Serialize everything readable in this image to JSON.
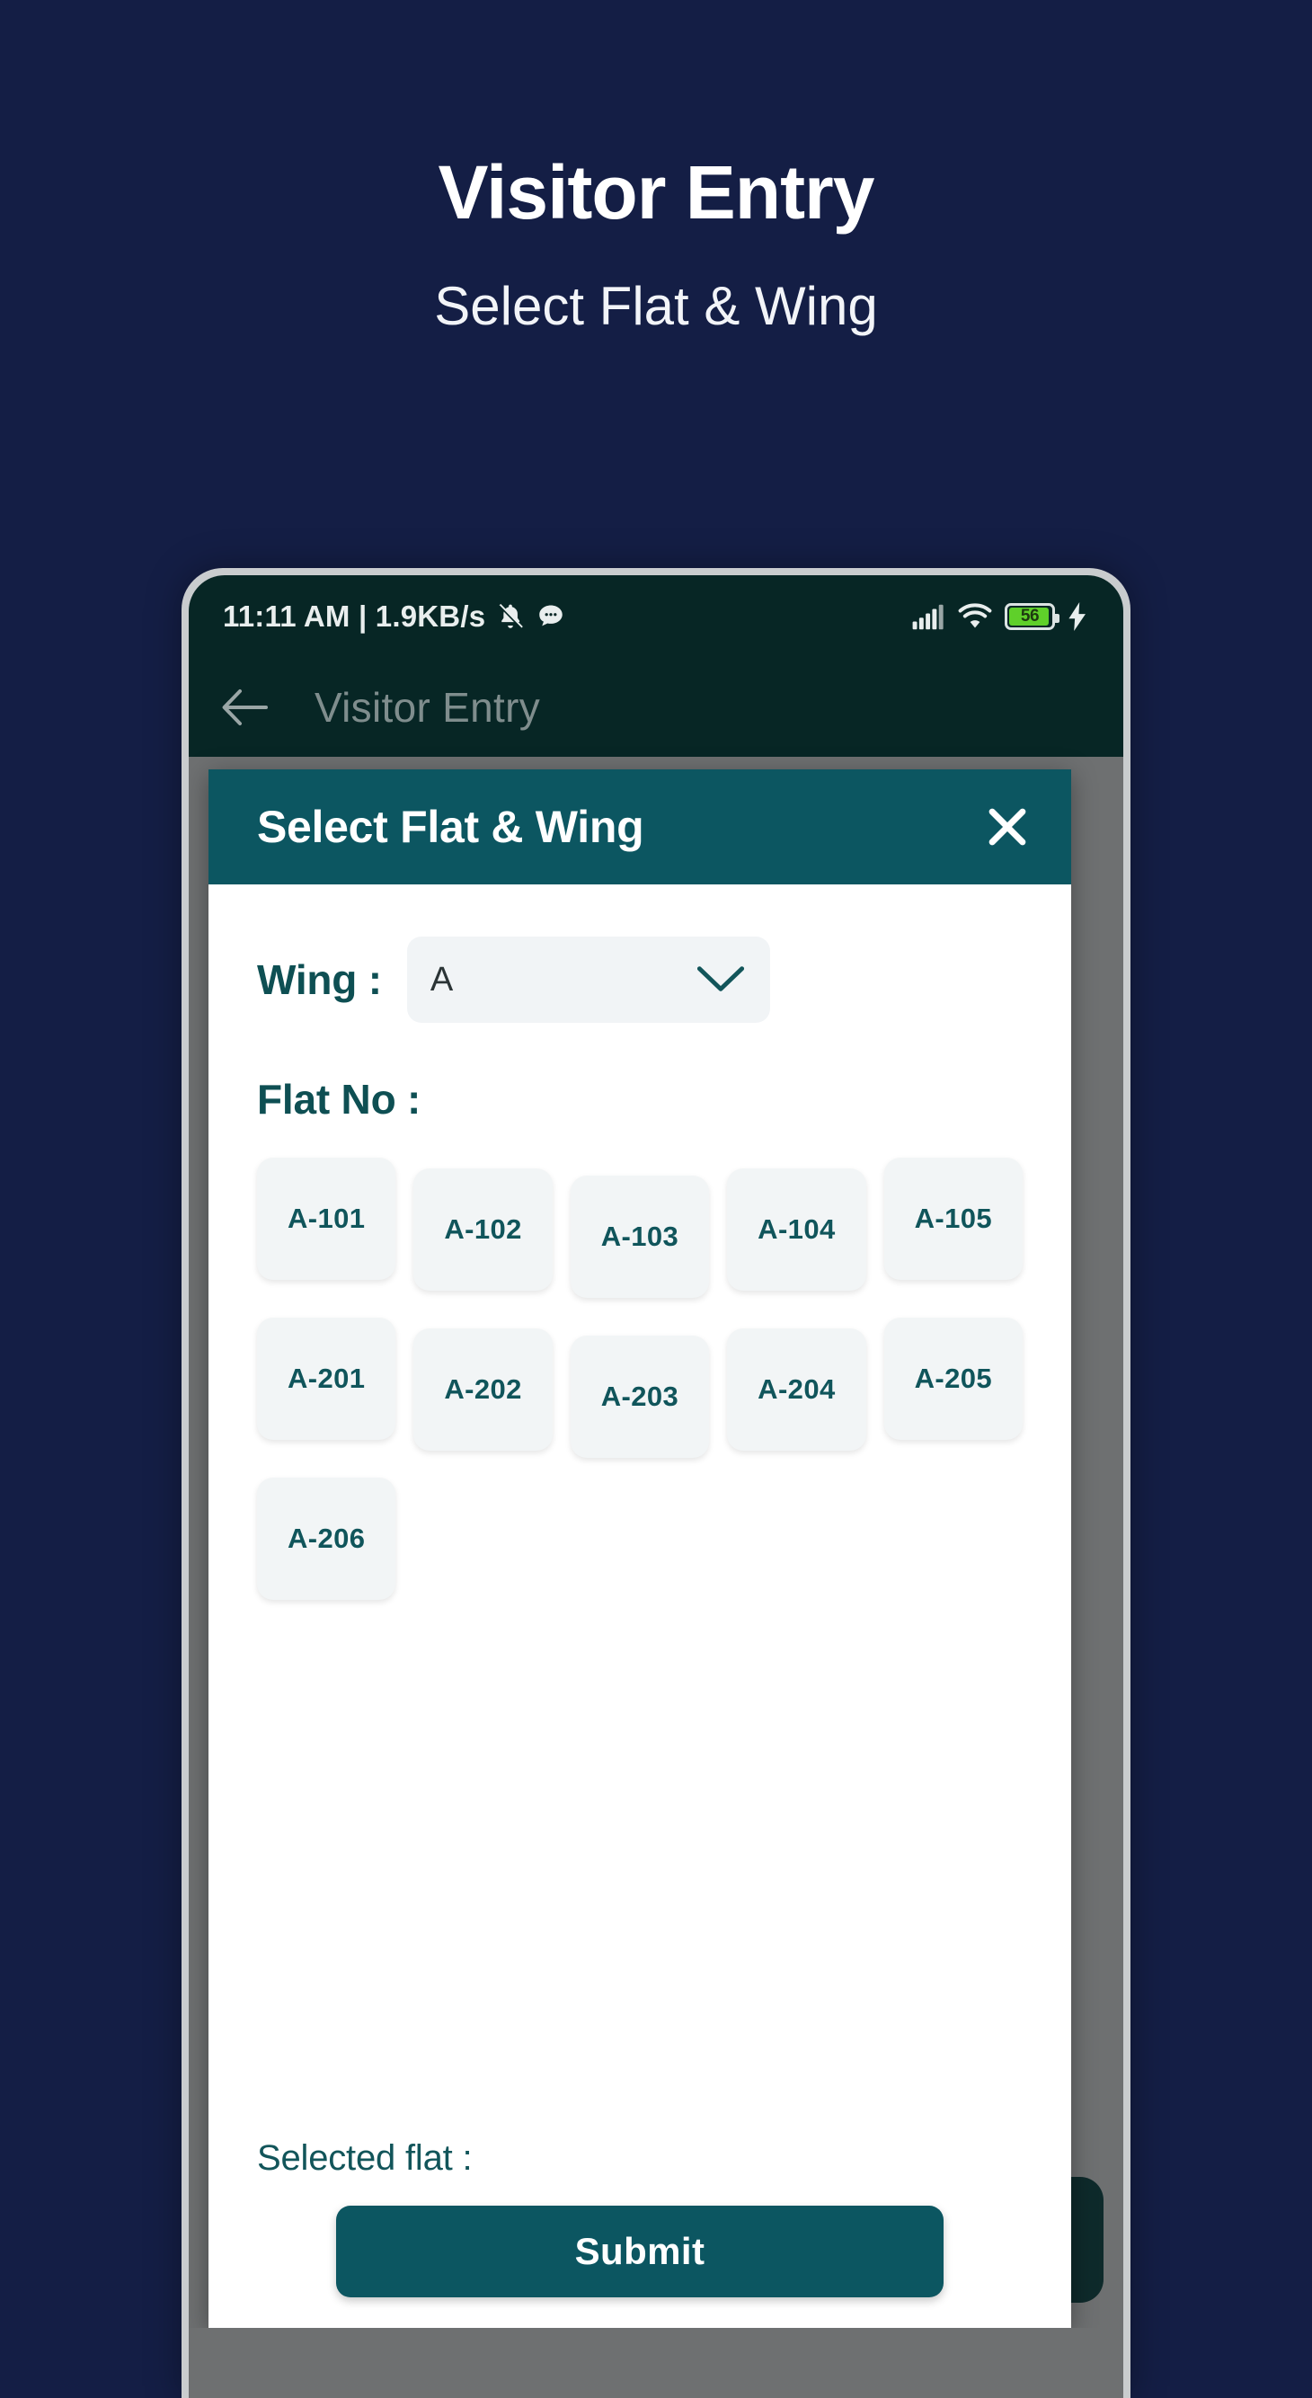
{
  "promo": {
    "title": "Visitor Entry",
    "subtitle": "Select Flat & Wing"
  },
  "phone": {
    "status_bar": {
      "left_text": "11:11 AM | 1.9KB/s",
      "bell_mute_icon": "bell-mute-icon",
      "chat_icon": "chat-bubble-icon",
      "signal_icon": "signal-bars-icon",
      "wifi_icon": "wifi-icon",
      "battery_icon": "battery-icon",
      "battery_level": "56",
      "charging_icon": "charging-bolt-icon"
    },
    "app_bar": {
      "back_icon": "back-arrow-icon",
      "title": "Visitor Entry"
    }
  },
  "dialog": {
    "title": "Select Flat & Wing",
    "close_icon": "close-x-icon",
    "wing": {
      "label": "Wing :",
      "selected": "A",
      "chevron_icon": "chevron-down-icon"
    },
    "flat": {
      "label": "Flat No :",
      "options": [
        "A-101",
        "A-102",
        "A-103",
        "A-104",
        "A-105",
        "A-201",
        "A-202",
        "A-203",
        "A-204",
        "A-205",
        "A-206"
      ]
    },
    "selected_flat_label": "Selected flat :",
    "selected_flat_value": "",
    "submit_label": "Submit"
  },
  "colors": {
    "page_background": "#141E45",
    "teal_primary": "#0C5661",
    "teal_text": "#0E4F53",
    "chip_background": "#F2F5F6",
    "battery_green": "#5FD02A",
    "screen_background": "#072625"
  }
}
